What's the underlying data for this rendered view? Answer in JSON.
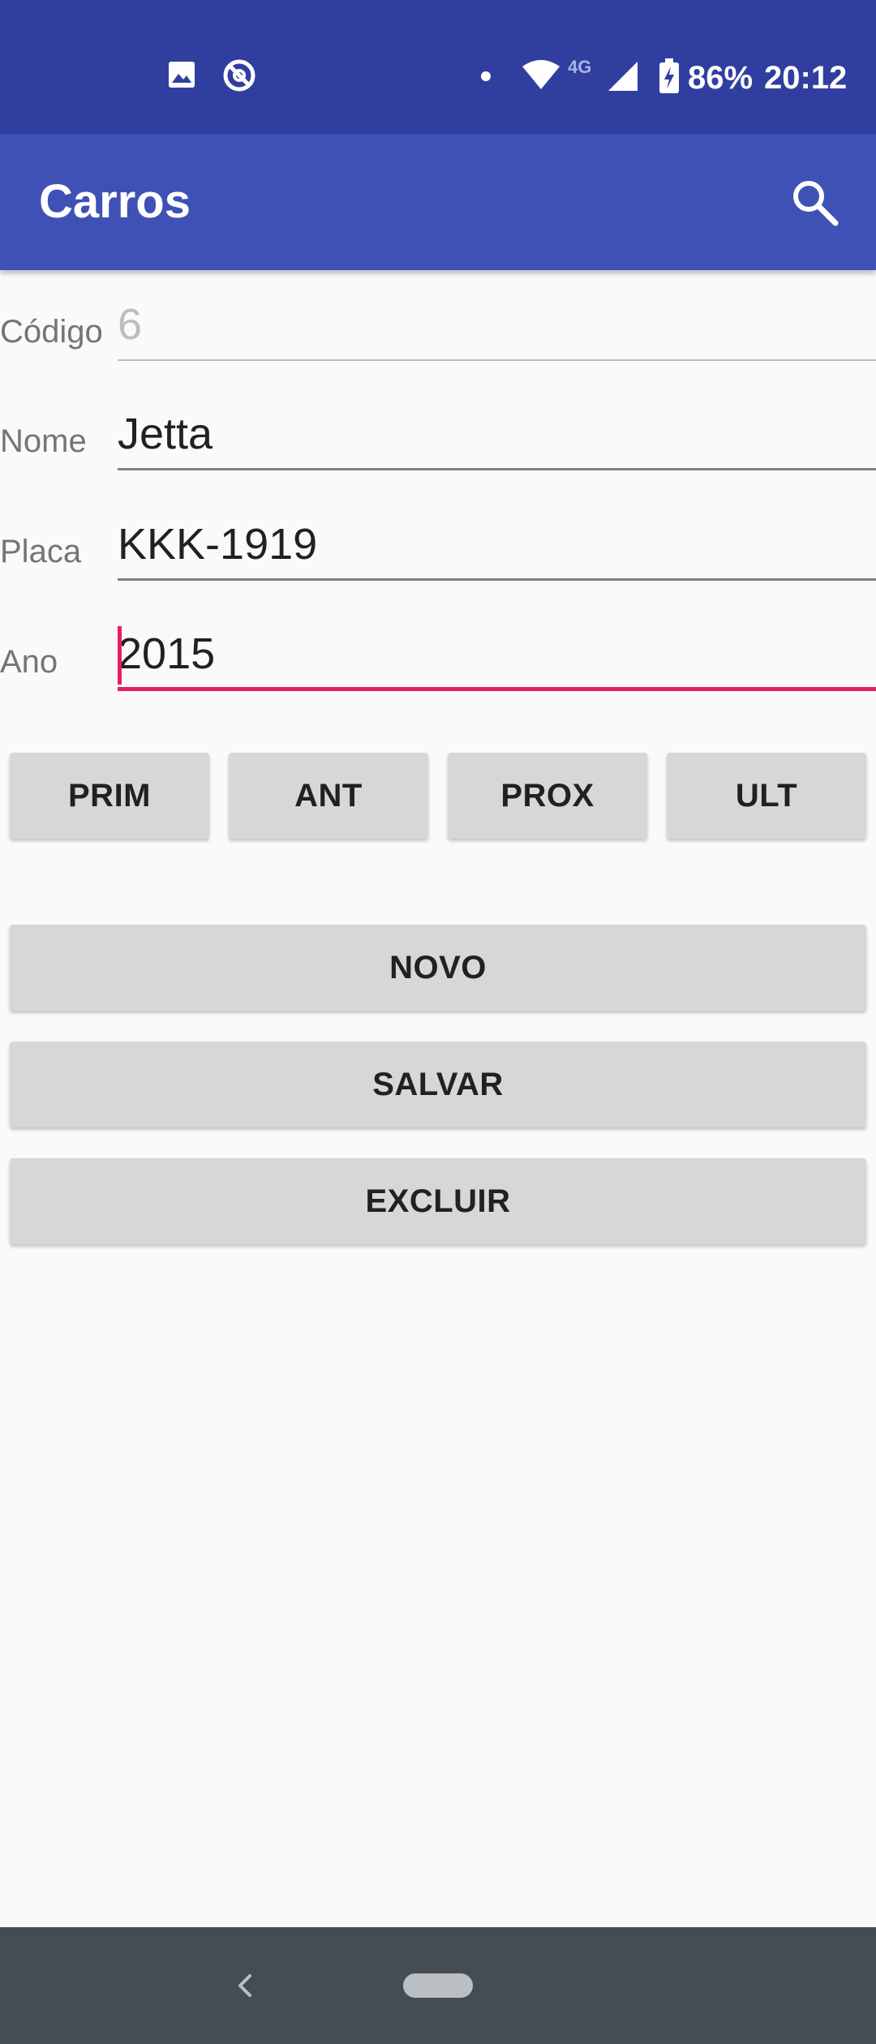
{
  "status_bar": {
    "battery": "86%",
    "time": "20:12",
    "network_type": "4G",
    "icons": [
      "image-icon",
      "sync-disabled-icon",
      "notification-dot-icon",
      "wifi-icon",
      "signal-icon",
      "battery-charging-icon"
    ]
  },
  "app_bar": {
    "title": "Carros",
    "search_icon": "search-icon"
  },
  "form": {
    "codigo": {
      "label": "Código",
      "value": "6"
    },
    "nome": {
      "label": "Nome",
      "value": "Jetta"
    },
    "placa": {
      "label": "Placa",
      "value": "KKK-1919"
    },
    "ano": {
      "label": "Ano",
      "value": "2015"
    }
  },
  "navigation_buttons": {
    "first": "PRIM",
    "previous": "ANT",
    "next": "PROX",
    "last": "ULT"
  },
  "actions": {
    "new": "NOVO",
    "save": "SALVAR",
    "delete": "EXCLUIR"
  },
  "system_nav": {
    "back_icon": "back-chevron-icon",
    "home_icon": "home-pill-icon"
  },
  "colors": {
    "status_bar": "#303f9f",
    "app_bar": "#3f51b5",
    "accent": "#e91e63",
    "button": "#d6d7d7",
    "nav_bar": "#454d54"
  }
}
